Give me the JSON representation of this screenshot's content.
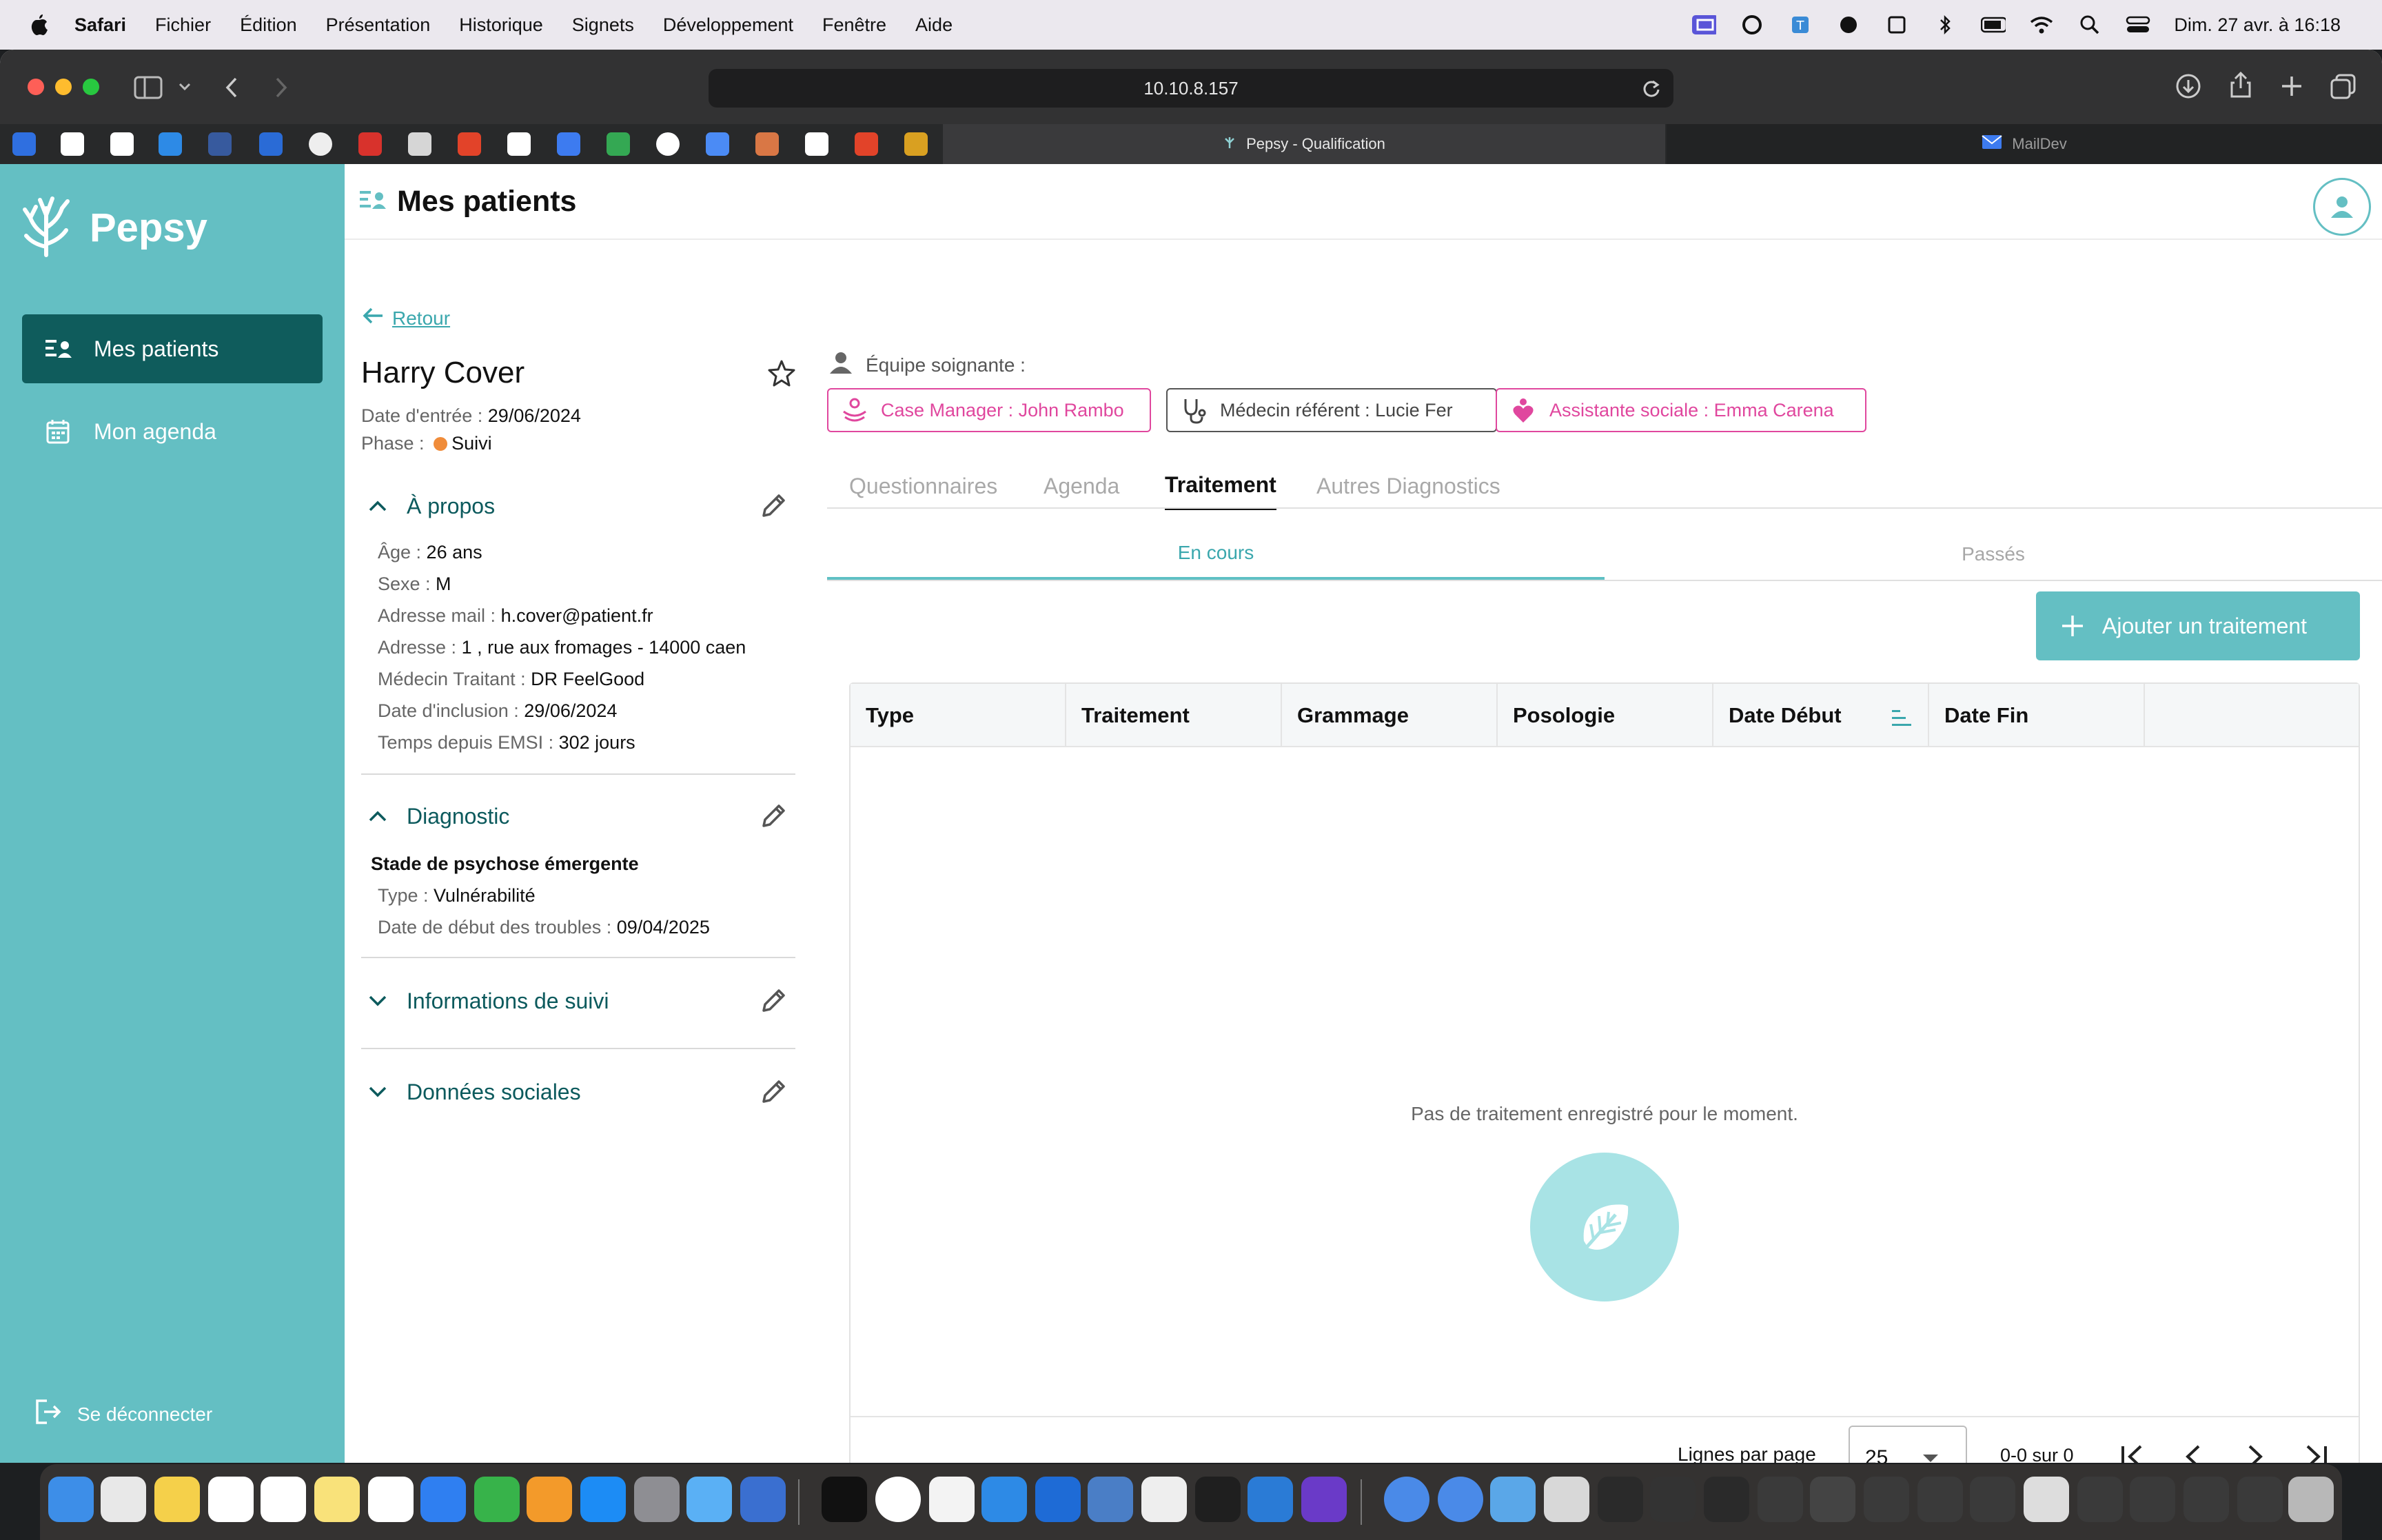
{
  "menubar": {
    "app": "Safari",
    "items": [
      "Fichier",
      "Édition",
      "Présentation",
      "Historique",
      "Signets",
      "Développement",
      "Fenêtre",
      "Aide"
    ],
    "clock": "Dim. 27 avr. à 16:18"
  },
  "browser": {
    "url": "10.10.8.157",
    "tab_active": "Pepsy - Qualification",
    "tab_other": "MailDev"
  },
  "sidebar": {
    "brand": "Pepsy",
    "items": [
      {
        "label": "Mes patients",
        "icon": "patients-list-icon"
      },
      {
        "label": "Mon agenda",
        "icon": "calendar-icon"
      }
    ],
    "logout": "Se déconnecter"
  },
  "header": {
    "title": "Mes patients"
  },
  "patient": {
    "back": "Retour",
    "name": "Harry Cover",
    "entry_label": "Date d'entrée : ",
    "entry_value": "29/06/2024",
    "phase_label": "Phase : ",
    "phase_value": "Suivi"
  },
  "about": {
    "title": "À propos",
    "fields": [
      {
        "label": "Âge : ",
        "value": "26 ans"
      },
      {
        "label": "Sexe : ",
        "value": "M"
      },
      {
        "label": "Adresse mail : ",
        "value": "h.cover@patient.fr"
      },
      {
        "label": "Adresse : ",
        "value": "1 , rue aux fromages - 14000 caen"
      },
      {
        "label": "Médecin Traitant : ",
        "value": "DR FeelGood"
      },
      {
        "label": "Date d'inclusion : ",
        "value": "29/06/2024"
      },
      {
        "label": "Temps depuis EMSI : ",
        "value": "302 jours"
      }
    ]
  },
  "diagnostic": {
    "title": "Diagnostic",
    "stage": "Stade de psychose émergente",
    "fields": [
      {
        "label": "Type : ",
        "value": "Vulnérabilité"
      },
      {
        "label": "Date de début des troubles : ",
        "value": "09/04/2025"
      }
    ]
  },
  "sections": {
    "followup": "Informations de suivi",
    "social": "Données sociales"
  },
  "team": {
    "label": "Équipe soignante :",
    "members": [
      "Case Manager : John Rambo",
      "Médecin référent : Lucie Fer",
      "Assistante sociale : Emma Carena"
    ]
  },
  "tabs": [
    "Questionnaires",
    "Agenda",
    "Traitement",
    "Autres Diagnostics"
  ],
  "subtabs": [
    "En cours",
    "Passés"
  ],
  "add_button": "Ajouter un traitement",
  "table": {
    "columns": [
      "Type",
      "Traitement",
      "Grammage",
      "Posologie",
      "Date Début",
      "Date Fin"
    ],
    "empty": "Pas de traitement enregistré pour le moment.",
    "rows_label": "Lignes par page",
    "rows_value": "25",
    "range": "0-0 sur 0"
  },
  "colors": {
    "sidebar": "#64bfc3",
    "sidebar_active": "#0f5c5c",
    "accent": "#3aa7ad",
    "chip_pink": "#e0479e",
    "phase_dot": "#f08c3a"
  }
}
